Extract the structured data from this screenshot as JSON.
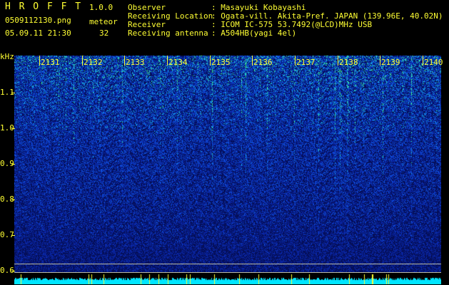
{
  "header": {
    "app_name": "H R O F F T",
    "version": "1.0.0",
    "filename": "0509112130.png",
    "datetime": "05.09.11 21:30",
    "meteor_label": "meteor",
    "meteor_count": "32",
    "observer_label": "Observer",
    "observer_value": ": Masayuki Kobayashi",
    "location_label": "Receiving Location",
    "location_value": ": Ogata-vill. Akita-Pref. JAPAN (139.96E, 40.02N)",
    "receiver_label": "Receiver",
    "receiver_value": ": ICOM IC-575 53.7492(@LCD)MHz USB",
    "antenna_label": "Receiving antenna",
    "antenna_value": ": A504HB(yagi 4el)"
  },
  "axis": {
    "unit": "kHz",
    "y_ticks": [
      "1.1",
      "1.0",
      "0.9",
      "0.8",
      "0.7",
      "0.6"
    ]
  },
  "time_markers": [
    "2131",
    "2132",
    "2133",
    "2134",
    "2135",
    "2136",
    "2137",
    "2138",
    "2139",
    "2140"
  ],
  "colors": {
    "text": "#ffff33",
    "background": "#000000",
    "spectro_low": "#0a2a9a",
    "spectro_high": "#33ff99",
    "baseline": "#00e5ff"
  }
}
